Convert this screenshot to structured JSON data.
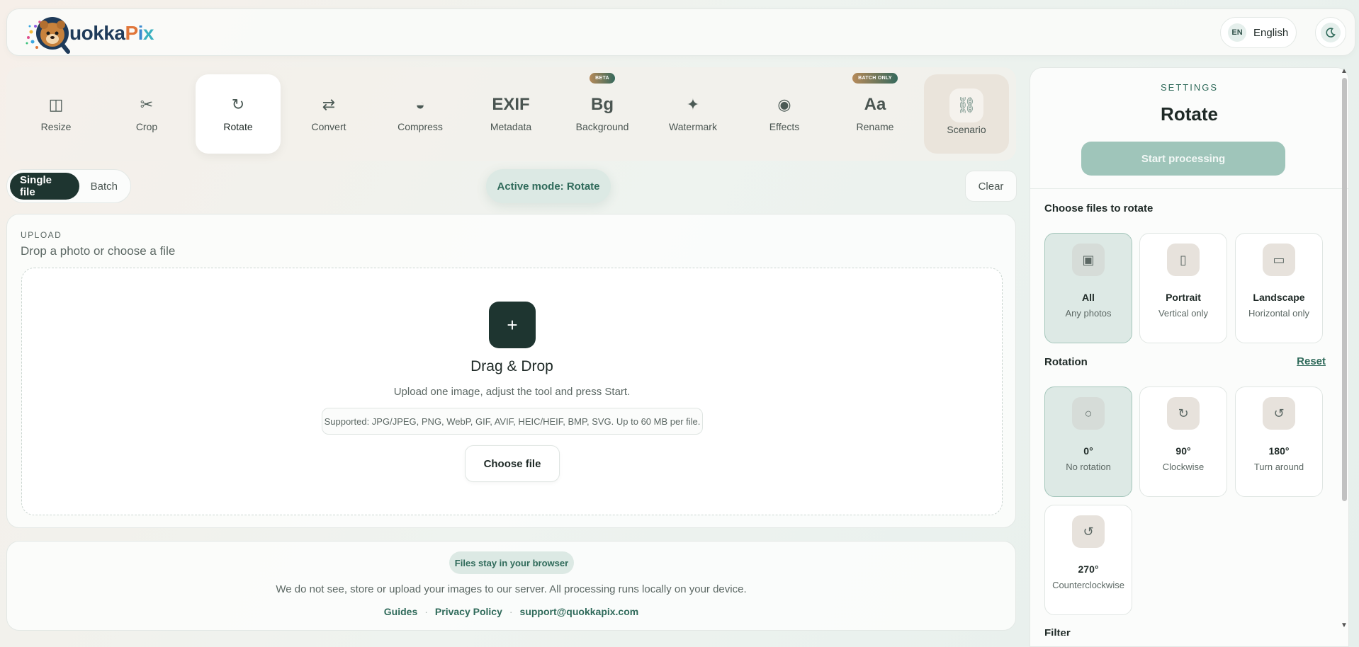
{
  "header": {
    "logo_text": "QuokkaPix",
    "language_code": "EN",
    "language_name": "English",
    "theme_icon": "moon-icon"
  },
  "tools": [
    {
      "label": "Resize",
      "icon": "resize-icon",
      "glyph": "◫"
    },
    {
      "label": "Crop",
      "icon": "scissors-icon",
      "glyph": "✂"
    },
    {
      "label": "Rotate",
      "icon": "rotate-icon",
      "glyph": "↻",
      "active": true
    },
    {
      "label": "Convert",
      "icon": "swap-icon",
      "glyph": "⇄"
    },
    {
      "label": "Compress",
      "icon": "half-circle-icon",
      "glyph": "◒"
    },
    {
      "label": "Metadata",
      "icon": "exif-icon",
      "glyph": "EXIF"
    },
    {
      "label": "Background",
      "icon": "bg-icon",
      "glyph": "Bg",
      "badge": "BETA"
    },
    {
      "label": "Watermark",
      "icon": "sparkle-icon",
      "glyph": "✦"
    },
    {
      "label": "Effects",
      "icon": "target-icon",
      "glyph": "◉"
    },
    {
      "label": "Rename",
      "icon": "text-icon",
      "glyph": "Aa",
      "badge": "BATCH ONLY"
    },
    {
      "label": "Scenario",
      "icon": "link-icon",
      "glyph": "⛓"
    }
  ],
  "mode": {
    "single_label": "Single file",
    "batch_label": "Batch",
    "active_mode_label": "Active mode: Rotate",
    "clear_label": "Clear"
  },
  "upload": {
    "eyebrow": "UPLOAD",
    "title": "Drop a photo or choose a file",
    "plus": "+",
    "dd_title": "Drag & Drop",
    "dd_sub": "Upload one image, adjust the tool and press Start.",
    "supported": "Supported: JPG/JPEG, PNG, WebP, GIF, AVIF, HEIC/HEIF, BMP, SVG. Up to 60 MB per file.",
    "choose_label": "Choose file"
  },
  "privacy": {
    "badge": "Files stay in your browser",
    "text": "We do not see, store or upload your images to our server. All processing runs locally on your device.",
    "links": [
      "Guides",
      "Privacy Policy",
      "support@quokkapix.com"
    ],
    "separator": "·"
  },
  "settings": {
    "eyebrow": "SETTINGS",
    "title": "Rotate",
    "start_label": "Start processing",
    "files_label": "Choose files to rotate",
    "file_options": [
      {
        "title": "All",
        "sub": "Any photos",
        "glyph": "▣",
        "selected": true
      },
      {
        "title": "Portrait",
        "sub": "Vertical only",
        "glyph": "▯"
      },
      {
        "title": "Landscape",
        "sub": "Horizontal only",
        "glyph": "▭"
      }
    ],
    "rotation_label": "Rotation",
    "reset_label": "Reset",
    "rotation_options": [
      {
        "title": "0°",
        "sub": "No rotation",
        "glyph": "○",
        "selected": true
      },
      {
        "title": "90°",
        "sub": "Clockwise",
        "glyph": "↻"
      },
      {
        "title": "180°",
        "sub": "Turn around",
        "glyph": "↺"
      },
      {
        "title": "270°",
        "sub": "Counterclockwise",
        "glyph": "↺"
      }
    ],
    "next_section_label": "Filter"
  },
  "colors": {
    "accent": "#2f6a5a",
    "dark": "#1e3530",
    "start_button": "#9fc5ba"
  }
}
